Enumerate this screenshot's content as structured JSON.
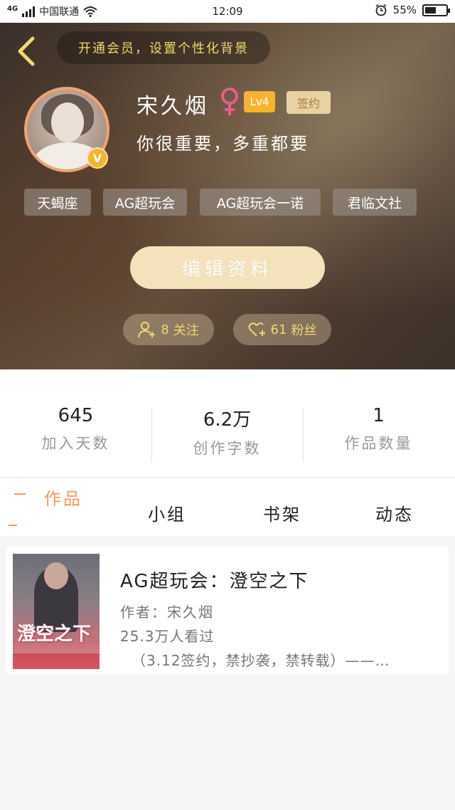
{
  "status_bar": {
    "network": "4G",
    "carrier": "中国联通",
    "time": "12:09",
    "battery": "55%",
    "battery_level": 0.55
  },
  "header": {
    "vip_banner": "开通会员，设置个性化背景",
    "username": "宋久烟",
    "gender_icon": "female-icon",
    "level": "Lv4",
    "signed_badge": "签约",
    "vip_badge": "V",
    "bio": "你很重要，多重都要",
    "tags": [
      "天蝎座",
      "AG超玩会",
      "AG超玩会一诺",
      "君临文社"
    ],
    "edit_button": "编辑资料",
    "follow": {
      "count": "8",
      "label": "关注"
    },
    "fans": {
      "count": "61",
      "label": "粉丝"
    }
  },
  "stats": [
    {
      "value": "645",
      "label": "加入天数"
    },
    {
      "value": "6.2万",
      "label": "创作字数"
    },
    {
      "value": "1",
      "label": "作品数量"
    }
  ],
  "tabs": [
    "作品",
    "小组",
    "书架",
    "动态"
  ],
  "active_tab": "作品",
  "works": [
    {
      "cover_text": "澄空之下",
      "title": "AG超玩会：澄空之下",
      "author": "作者：宋久烟",
      "views": "25.3万人看过",
      "note": "（3.12签约，禁抄袭，禁转载）——…"
    }
  ],
  "colors": {
    "accent": "#f39a5c",
    "gold": "#f3d871",
    "level_badge": "#f4b430"
  }
}
